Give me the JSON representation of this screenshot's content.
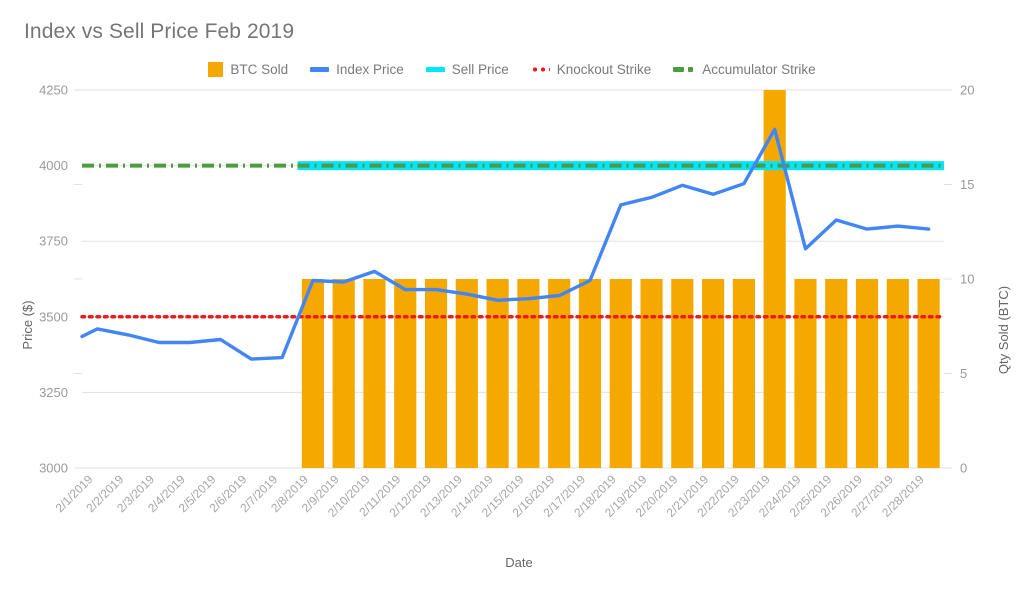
{
  "chart_data": {
    "type": "bar",
    "title": "Index vs Sell Price Feb 2019",
    "xlabel": "Date",
    "ylabel": "Price ($)",
    "y2label": "Qty Sold (BTC)",
    "grid": true,
    "legend_position": "top-center",
    "ylim": [
      3000,
      4250
    ],
    "y2lim": [
      0,
      20
    ],
    "yticks": [
      3000,
      3250,
      3500,
      3750,
      4000,
      4250
    ],
    "y2ticks": [
      0,
      5,
      10,
      15,
      20
    ],
    "categories": [
      "2/1/2019",
      "2/2/2019",
      "2/3/2019",
      "2/4/2019",
      "2/5/2019",
      "2/6/2019",
      "2/7/2019",
      "2/8/2019",
      "2/9/2019",
      "2/10/2019",
      "2/11/2019",
      "2/12/2019",
      "2/13/2019",
      "2/14/2019",
      "2/15/2019",
      "2/16/2019",
      "2/17/2019",
      "2/18/2019",
      "2/19/2019",
      "2/20/2019",
      "2/21/2019",
      "2/22/2019",
      "2/23/2019",
      "2/24/2019",
      "2/25/2019",
      "2/26/2019",
      "2/27/2019",
      "2/28/2019"
    ],
    "series": [
      {
        "name": "BTC Sold",
        "type": "bar",
        "axis": "right",
        "color": "#F5A800",
        "values": [
          0,
          0,
          0,
          0,
          0,
          0,
          0,
          10,
          10,
          10,
          10,
          10,
          10,
          10,
          10,
          10,
          10,
          10,
          10,
          10,
          10,
          10,
          20,
          10,
          10,
          10,
          10,
          10
        ]
      },
      {
        "name": "Index Price",
        "type": "line",
        "axis": "left",
        "color": "#4285F4",
        "values": [
          3435,
          3460,
          3440,
          3415,
          3415,
          3425,
          3360,
          3365,
          3620,
          3615,
          3650,
          3590,
          3590,
          3575,
          3555,
          3560,
          3570,
          3620,
          3870,
          3895,
          3935,
          3905,
          3940,
          4120,
          3725,
          3820,
          3790,
          3800,
          3790
        ]
      },
      {
        "name": "Sell Price",
        "type": "line",
        "axis": "left",
        "color": "#00E5FF",
        "style": "solid",
        "start_category": "2/8/2019",
        "value": 4000
      },
      {
        "name": "Knockout Strike",
        "type": "line",
        "axis": "left",
        "color": "#EA1C1C",
        "style": "dotted",
        "value": 3500
      },
      {
        "name": "Accumulator Strike",
        "type": "line",
        "axis": "left",
        "color": "#4E9A3E",
        "style": "dash-dot",
        "value": 4000
      }
    ]
  },
  "legend": {
    "items": [
      {
        "label": "BTC Sold",
        "color": "#F5A800",
        "marker": "square"
      },
      {
        "label": "Index Price",
        "color": "#4285F4",
        "marker": "line"
      },
      {
        "label": "Sell Price",
        "color": "#00E5FF",
        "marker": "line"
      },
      {
        "label": "Knockout Strike",
        "color": "#EA1C1C",
        "marker": "dotted"
      },
      {
        "label": "Accumulator Strike",
        "color": "#4E9A3E",
        "marker": "dash-dot"
      }
    ]
  },
  "colors": {
    "bar": "#F5A800",
    "index_line": "#4285F4",
    "sell_line": "#00E5FF",
    "knockout_line": "#EA1C1C",
    "accumulator_line": "#4E9A3E",
    "grid": "#e0e0e0",
    "text": "#757575",
    "tick_text": "#9a9a9a",
    "background": "#ffffff"
  }
}
